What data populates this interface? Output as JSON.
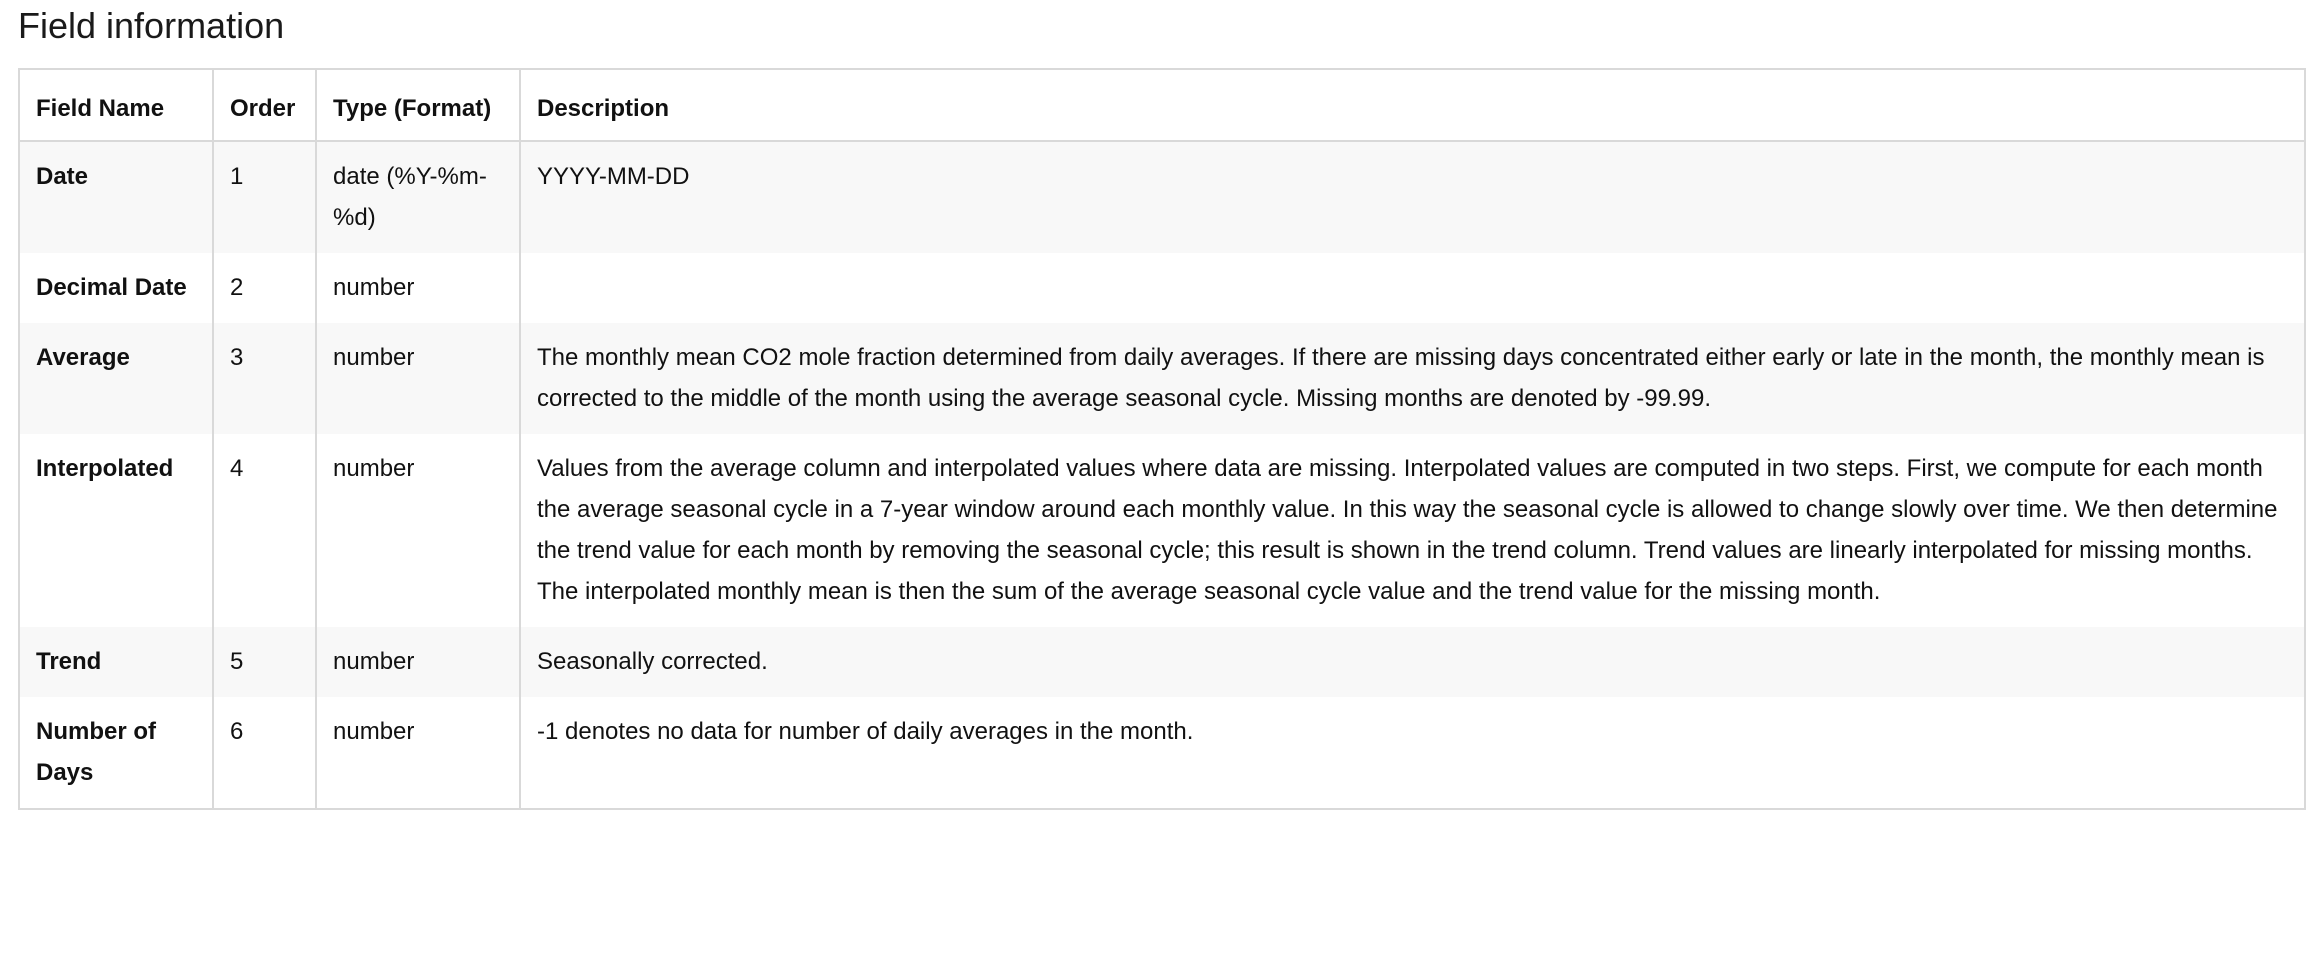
{
  "title": "Field information",
  "table": {
    "headers": {
      "field_name": "Field Name",
      "order": "Order",
      "type": "Type (Format)",
      "description": "Description"
    },
    "rows": [
      {
        "field_name": "Date",
        "order": "1",
        "type": "date (%Y-%m-%d)",
        "description": "YYYY-MM-DD"
      },
      {
        "field_name": "Decimal Date",
        "order": "2",
        "type": "number",
        "description": ""
      },
      {
        "field_name": "Average",
        "order": "3",
        "type": "number",
        "description": "The monthly mean CO2 mole fraction determined from daily averages. If there are missing days concentrated either early or late in the month, the monthly mean is corrected to the middle of the month using the average seasonal cycle. Missing months are denoted by -99.99."
      },
      {
        "field_name": "Interpolated",
        "order": "4",
        "type": "number",
        "description": "Values from the average column and interpolated values where data are missing. Interpolated values are computed in two steps. First, we compute for each month the average seasonal cycle in a 7-year window around each monthly value. In this way the seasonal cycle is allowed to change slowly over time. We then determine the trend value for each month by removing the seasonal cycle; this result is shown in the trend column. Trend values are linearly interpolated for missing months. The interpolated monthly mean is then the sum of the average seasonal cycle value and the trend value for the missing month."
      },
      {
        "field_name": "Trend",
        "order": "5",
        "type": "number",
        "description": "Seasonally corrected."
      },
      {
        "field_name": "Number of Days",
        "order": "6",
        "type": "number",
        "description": "-1 denotes no data for number of daily averages in the month."
      }
    ]
  }
}
